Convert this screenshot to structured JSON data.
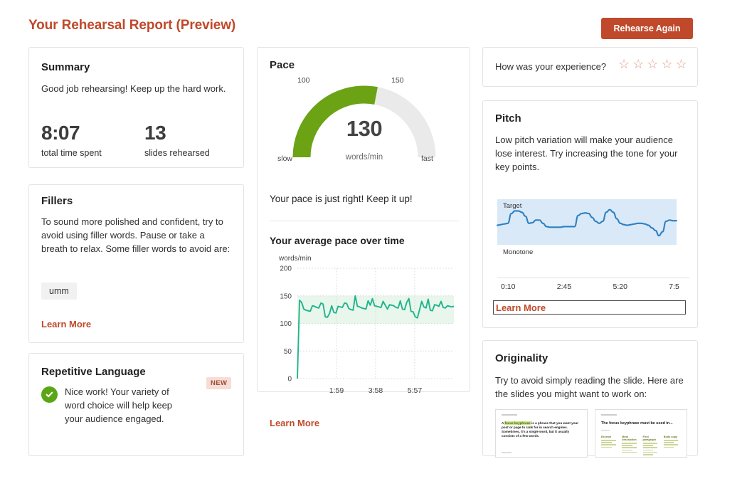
{
  "header": {
    "title": "Your Rehearsal Report (Preview)",
    "rehearse_button": "Rehearse Again",
    "accent_color": "#c0492b"
  },
  "summary": {
    "title": "Summary",
    "text": "Good job rehearsing! Keep up the hard work.",
    "stats": [
      {
        "value": "8:07",
        "label": "total time spent"
      },
      {
        "value": "13",
        "label": "slides rehearsed"
      }
    ]
  },
  "fillers": {
    "title": "Fillers",
    "text": "To sound more polished and confident, try to avoid using filler words. Pause or take a breath to relax. Some filler words to avoid are:",
    "words": [
      "umm"
    ],
    "learn_more": "Learn More"
  },
  "repetitive": {
    "title": "Repetitive Language",
    "badge": "NEW",
    "text": "Nice work! Your variety of word choice will help keep your audience engaged.",
    "status_icon": "check-circle-icon",
    "status_color": "#5aa615"
  },
  "pace": {
    "title": "Pace",
    "gauge": {
      "value": "130",
      "units": "words/min",
      "left_label": "slow",
      "right_label": "fast",
      "tick_low": "100",
      "tick_high": "150",
      "fill_color": "#6ba315",
      "track_color": "#eaeaea",
      "fraction": 0.56
    },
    "message": "Your pace is just right! Keep it up!",
    "subtitle": "Your average pace over time",
    "learn_more": "Learn More"
  },
  "experience": {
    "question": "How was your experience?",
    "stars": [
      "☆",
      "☆",
      "☆",
      "☆",
      "☆"
    ],
    "star_color": "#e0a08f"
  },
  "pitch": {
    "title": "Pitch",
    "text": "Low pitch variation will make your audience lose interest. Try increasing the tone for your key points.",
    "band_top_label": "Target",
    "band_bottom_label": "Monotone",
    "learn_more": "Learn More"
  },
  "originality": {
    "title": "Originality",
    "text": "Try to avoid simply reading the slide. Here are the slides you might want to work on:",
    "slides": [
      {
        "body_prefix": "A ",
        "body_highlight": "focus keyphrase",
        "body_rest": " is a phrase that you want your post or page to rank for in search engines. Sometimes, it's a single word, but it usually consists of a few words."
      },
      {
        "title": "The focus keyphrase must be used in...",
        "columns": [
          "Excerpt",
          "Meta description",
          "First paragraph",
          "Body copy"
        ]
      }
    ]
  },
  "chart_data": [
    {
      "type": "line",
      "title": "Your average pace over time",
      "ylabel": "words/min",
      "xlabel": "",
      "ylim": [
        0,
        200
      ],
      "yticks": [
        0,
        50,
        100,
        150,
        200
      ],
      "xticks": [
        "1:59",
        "3:58",
        "5:57"
      ],
      "grid": true,
      "band": {
        "from": 100,
        "to": 150,
        "color": "#e8f6ec"
      },
      "line_color": "#21b48c",
      "values": [
        0,
        142,
        138,
        126,
        124,
        123,
        122,
        132,
        131,
        129,
        128,
        137,
        135,
        112,
        111,
        118,
        132,
        120,
        119,
        131,
        130,
        129,
        137,
        136,
        127,
        125,
        124,
        150,
        131,
        130,
        128,
        127,
        126,
        141,
        133,
        145,
        132,
        131,
        130,
        129,
        140,
        133,
        126,
        134,
        133,
        132,
        129,
        128,
        141,
        126,
        125,
        138,
        145,
        122,
        121,
        112,
        110,
        125,
        140,
        130,
        128,
        144,
        124,
        123,
        134,
        133,
        131,
        140,
        129,
        128,
        132,
        131,
        130,
        131
      ]
    },
    {
      "type": "line",
      "title": "Pitch",
      "ylabel": "",
      "xlabel": "",
      "xticks": [
        "0:10",
        "2:45",
        "5:20",
        "7:5"
      ],
      "grid": false,
      "band_label_top": "Target",
      "band_label_bottom": "Monotone",
      "band_color": "#d9e9f8",
      "line_color": "#2d7fc1",
      "values": [
        30,
        31,
        32,
        33,
        48,
        52,
        52,
        50,
        44,
        33,
        34,
        38,
        38,
        33,
        28,
        27,
        27,
        27,
        27,
        28,
        28,
        28,
        28,
        45,
        48,
        49,
        48,
        42,
        36,
        33,
        36,
        50,
        54,
        50,
        40,
        33,
        31,
        30,
        31,
        32,
        33,
        33,
        32,
        30,
        26,
        22,
        14,
        20,
        36,
        38,
        37,
        37
      ]
    }
  ]
}
